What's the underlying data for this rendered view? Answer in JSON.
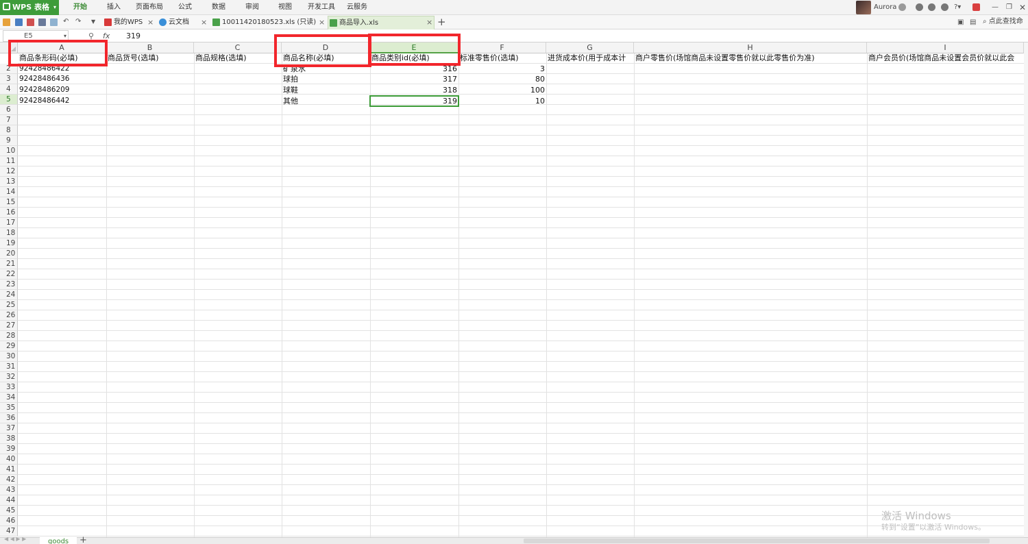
{
  "app": {
    "name": "WPS 表格",
    "menus": [
      "开始",
      "插入",
      "页面布局",
      "公式",
      "数据",
      "审阅",
      "视图",
      "开发工具",
      "云服务"
    ],
    "user": "Aurora"
  },
  "tabs": [
    {
      "label": "我的WPS"
    },
    {
      "label": "云文档"
    },
    {
      "label": "10011420180523.xls (只读) *"
    },
    {
      "label": "商品导入.xls"
    }
  ],
  "search_hint": "点此查找命",
  "formula": {
    "name_box": "E5",
    "fx_label": "fx",
    "value": "319"
  },
  "columns": [
    "A",
    "B",
    "C",
    "D",
    "E",
    "F",
    "G",
    "H",
    "I"
  ],
  "headers": [
    "商品条形码(必填)",
    "商品货号(选填)",
    "商品规格(选填)",
    "商品名称(必填)",
    "商品类别id(必填)",
    "标准零售价(选填)",
    "进货成本价(用于成本计",
    "商户零售价(场馆商品未设置零售价就以此零售价为准)",
    "商户会员价(场馆商品未设置会员价就以此会"
  ],
  "rows": [
    {
      "a": "92428486422",
      "d": "矿泉水",
      "e": "316",
      "f": "3"
    },
    {
      "a": "92428486436",
      "d": "球拍",
      "e": "317",
      "f": "80"
    },
    {
      "a": "92428486209",
      "d": "球鞋",
      "e": "318",
      "f": "100"
    },
    {
      "a": "92428486442",
      "d": "其他",
      "e": "319",
      "f": "10"
    }
  ],
  "row_numbers": [
    "2",
    "3",
    "4",
    "5",
    "6",
    "7",
    "8",
    "9",
    "10",
    "11",
    "12",
    "13",
    "14",
    "15",
    "16",
    "17",
    "18",
    "19",
    "20",
    "21",
    "22",
    "23",
    "24",
    "25",
    "26",
    "27",
    "28",
    "29",
    "30",
    "31",
    "32",
    "33",
    "34",
    "35",
    "36",
    "37",
    "38",
    "39",
    "40",
    "41",
    "42",
    "43",
    "44",
    "45",
    "46",
    "47"
  ],
  "sheet_tab": "goods",
  "watermark": {
    "line1": "激活 Windows",
    "line2": "转到“设置”以激活 Windows。"
  },
  "colors": {
    "accent_green": "#3e9c3a",
    "highlight_red": "#f2262c"
  }
}
